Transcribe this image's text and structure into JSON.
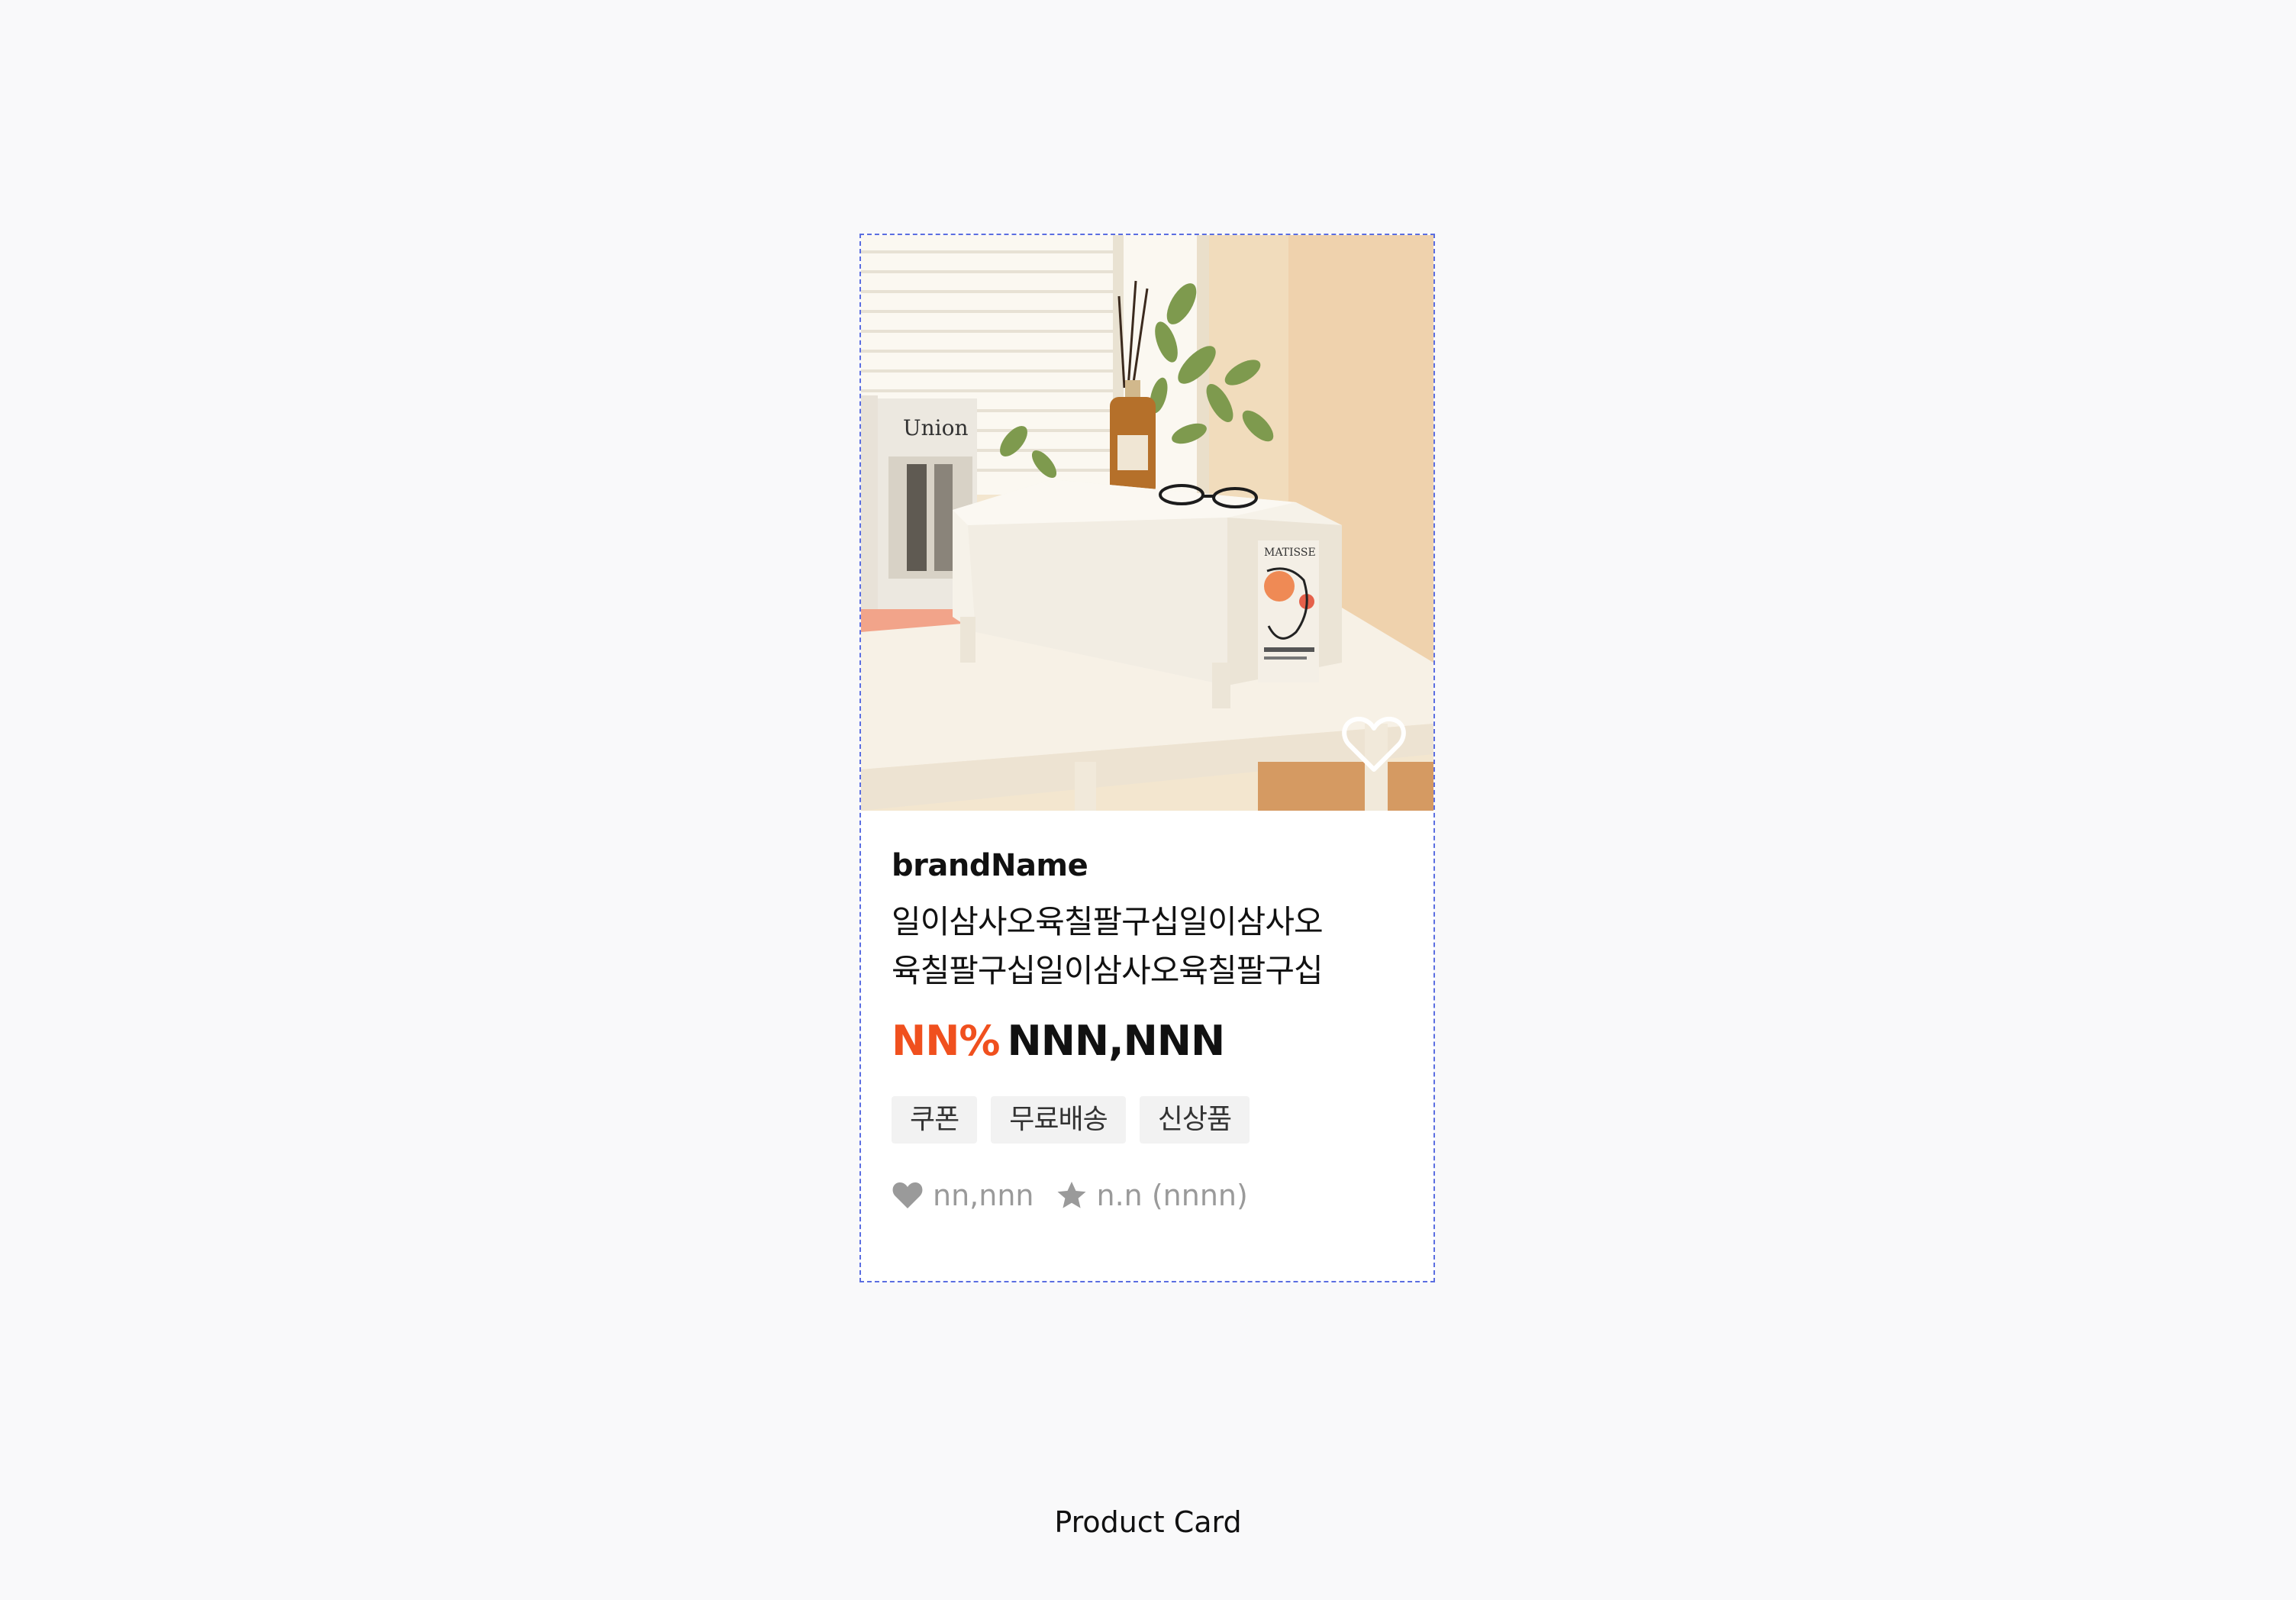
{
  "product_card": {
    "brand": "brandName",
    "title": "일이삼사오육칠팔구십일이삼사오육칠팔구십일이삼사오육칠팔구십",
    "discount": "NN%",
    "price": "NNN,NNN",
    "tags": [
      "쿠폰",
      "무료배송",
      "신상품"
    ],
    "likes": "nn,nnn",
    "rating": "n.n (nnnn)",
    "wished": false,
    "image_texts": {
      "book_title": "Union",
      "poster_title": "MATISSE"
    }
  },
  "caption": "Product Card",
  "colors": {
    "discount": "#f0501e",
    "outline": "#5b6ee1",
    "muted": "#9a9a9a",
    "tag_bg": "#f2f2f2"
  },
  "icons": {
    "wish": "heart-outline-icon",
    "likes": "heart-filled-icon",
    "rating": "star-icon"
  }
}
